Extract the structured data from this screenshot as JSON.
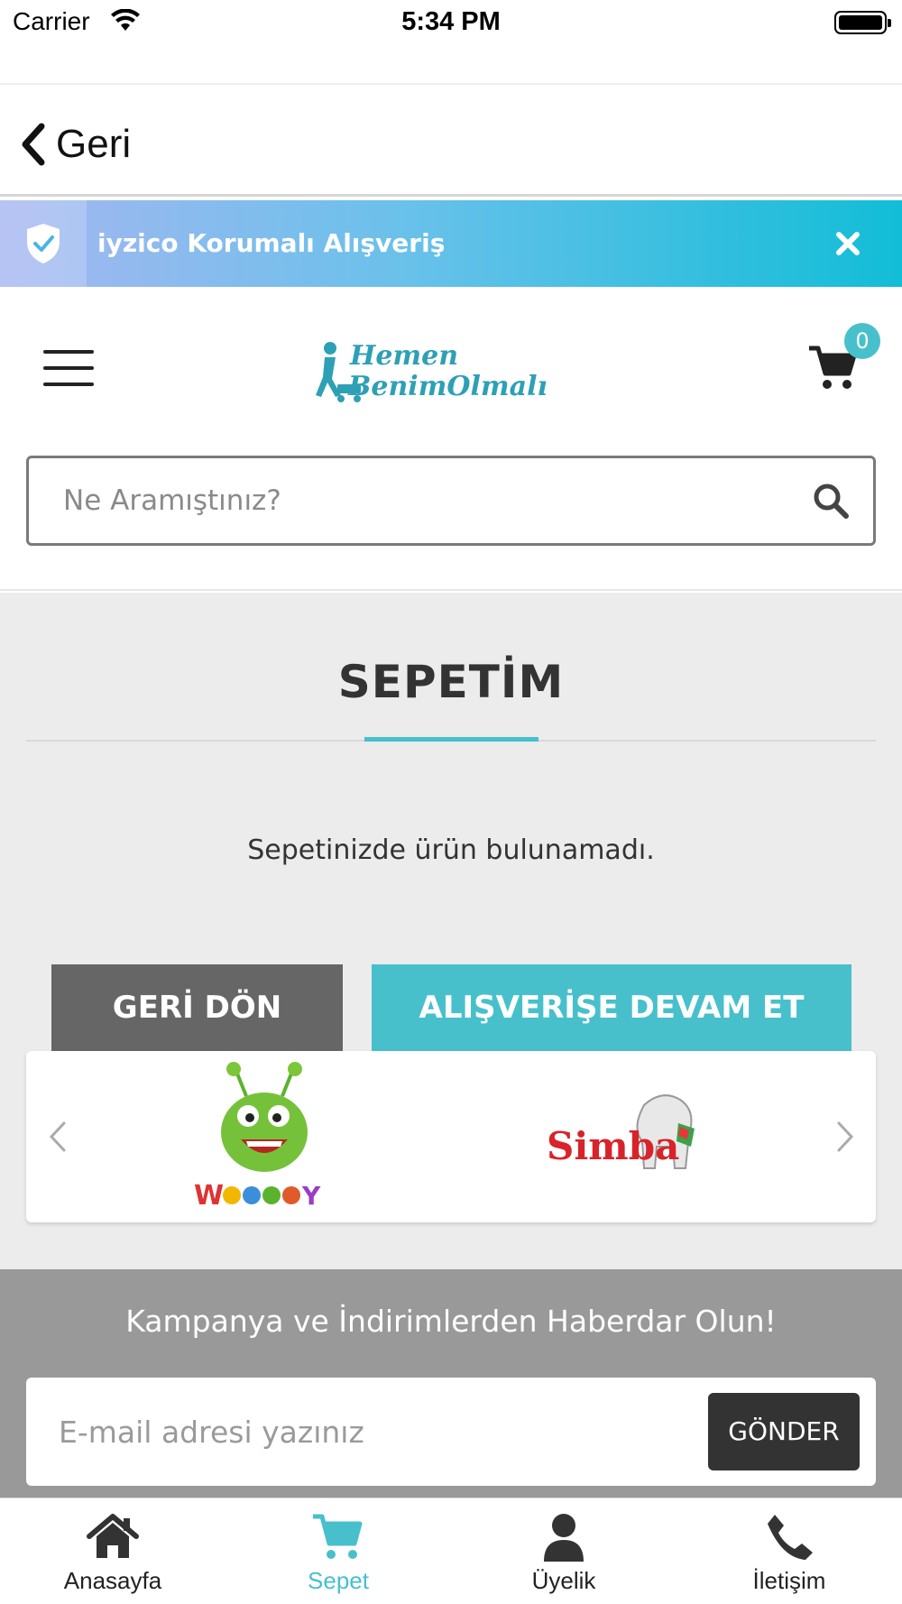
{
  "status_bar": {
    "carrier": "Carrier",
    "time": "5:34 PM"
  },
  "nav": {
    "back_label": "Geri"
  },
  "iyzico_banner": {
    "text": "iyzico Korumalı Alışveriş"
  },
  "header": {
    "logo_text_line1": "Hemen",
    "logo_text_line2": "BenimOlmalı",
    "cart_count": "0",
    "search_placeholder": "Ne Aramıştınız?"
  },
  "main": {
    "title": "SEPETİM",
    "empty_message": "Sepetinizde ürün bulunamadı.",
    "back_button": "GERİ DÖN",
    "continue_button": "ALIŞVERİŞE DEVAM ET",
    "brands": [
      {
        "name": "Woodoy"
      },
      {
        "name": "Simba"
      }
    ]
  },
  "newsletter": {
    "title": "Kampanya ve İndirimlerden Haberdar Olun!",
    "email_placeholder": "E-mail adresi yazınız",
    "send_button": "GÖNDER"
  },
  "tabs": [
    {
      "label": "Anasayfa",
      "icon": "home-icon",
      "active": false
    },
    {
      "label": "Sepet",
      "icon": "cart-icon",
      "active": true
    },
    {
      "label": "Üyelik",
      "icon": "user-icon",
      "active": false
    },
    {
      "label": "İletişim",
      "icon": "phone-icon",
      "active": false
    }
  ],
  "colors": {
    "accent": "#47c0cc",
    "back_button": "#666666",
    "newsletter_bg": "#999999",
    "main_bg": "#ececec"
  }
}
